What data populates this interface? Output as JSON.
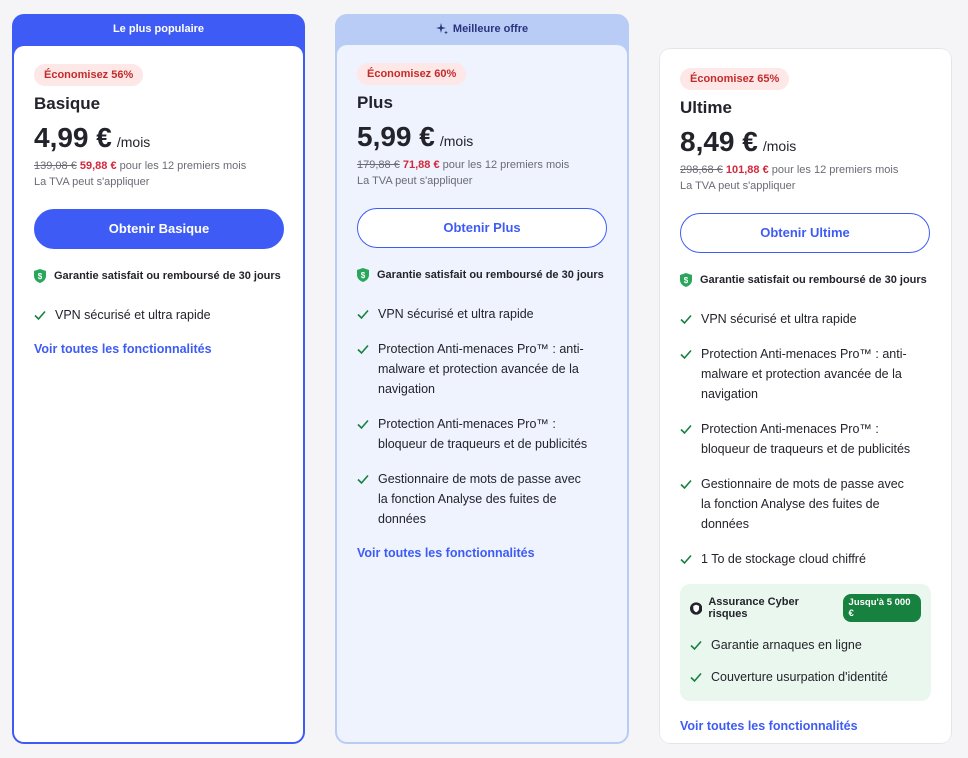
{
  "colors": {
    "accent": "#3e5cf5",
    "discount_red": "#d3283d",
    "check_green": "#17813f",
    "shield_green": "#28a65a"
  },
  "plans": [
    {
      "banner": "Le plus populaire",
      "save_badge": "Économisez 56%",
      "name": "Basique",
      "price": "4,99 €",
      "per": "/mois",
      "old_price": "139,08 €",
      "new_price": "59,88 €",
      "period_note": "pour les 12 premiers mois",
      "vat": "La TVA peut s'appliquer",
      "cta": "Obtenir Basique",
      "guarantee": "Garantie satisfait ou remboursé de 30 jours",
      "features": [
        "VPN sécurisé et ultra rapide"
      ],
      "see_all": "Voir toutes les fonctionnalités"
    },
    {
      "banner": "Meilleure offre",
      "banner_icon": "sparkle-icon",
      "save_badge": "Économisez 60%",
      "name": "Plus",
      "price": "5,99 €",
      "per": "/mois",
      "old_price": "179,88 €",
      "new_price": "71,88 €",
      "period_note": "pour les 12 premiers mois",
      "vat": "La TVA peut s'appliquer",
      "cta": "Obtenir Plus",
      "guarantee": "Garantie satisfait ou remboursé de 30 jours",
      "features": [
        "VPN sécurisé et ultra rapide",
        "Protection Anti-menaces Pro™ : anti-malware et protection avancée de la navigation",
        "Protection Anti-menaces Pro™ : bloqueur de traqueurs et de publicités",
        "Gestionnaire de mots de passe avec la fonction Analyse des fuites de données"
      ],
      "see_all": "Voir toutes les fonctionnalités"
    },
    {
      "save_badge": "Économisez 65%",
      "name": "Ultime",
      "price": "8,49 €",
      "per": "/mois",
      "old_price": "298,68 €",
      "new_price": "101,88 €",
      "period_note": "pour les 12 premiers mois",
      "vat": "La TVA peut s'appliquer",
      "cta": "Obtenir Ultime",
      "guarantee": "Garantie satisfait ou remboursé de 30 jours",
      "features": [
        "VPN sécurisé et ultra rapide",
        "Protection Anti-menaces Pro™ : anti-malware et protection avancée de la navigation",
        "Protection Anti-menaces Pro™ : bloqueur de traqueurs et de publicités",
        "Gestionnaire de mots de passe avec la fonction Analyse des fuites de données",
        "1 To de stockage cloud chiffré"
      ],
      "insurance": {
        "title": "Assurance Cyber risques",
        "badge": "Jusqu'à 5 000 €",
        "items": [
          "Garantie arnaques en ligne",
          "Couverture usurpation d'identité"
        ]
      },
      "see_all": "Voir toutes les fonctionnalités"
    }
  ]
}
